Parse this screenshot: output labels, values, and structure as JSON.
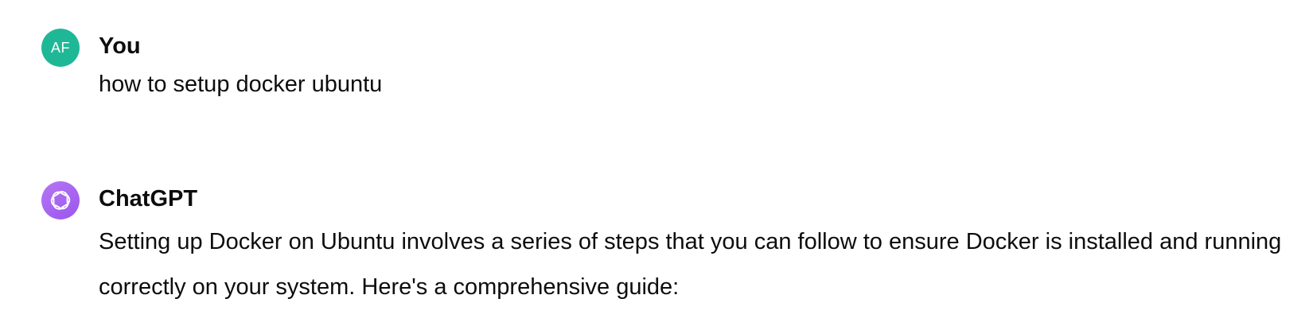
{
  "conversation": {
    "user_message": {
      "avatar_initials": "AF",
      "avatar_color": "#1fb897",
      "author": "You",
      "text": "how to setup docker ubuntu"
    },
    "assistant_message": {
      "avatar_icon": "openai-logo-icon",
      "avatar_color": "#ab68ff",
      "author": "ChatGPT",
      "text": "Setting up Docker on Ubuntu involves a series of steps that you can follow to ensure Docker is installed and running correctly on your system. Here's a comprehensive guide:"
    }
  }
}
